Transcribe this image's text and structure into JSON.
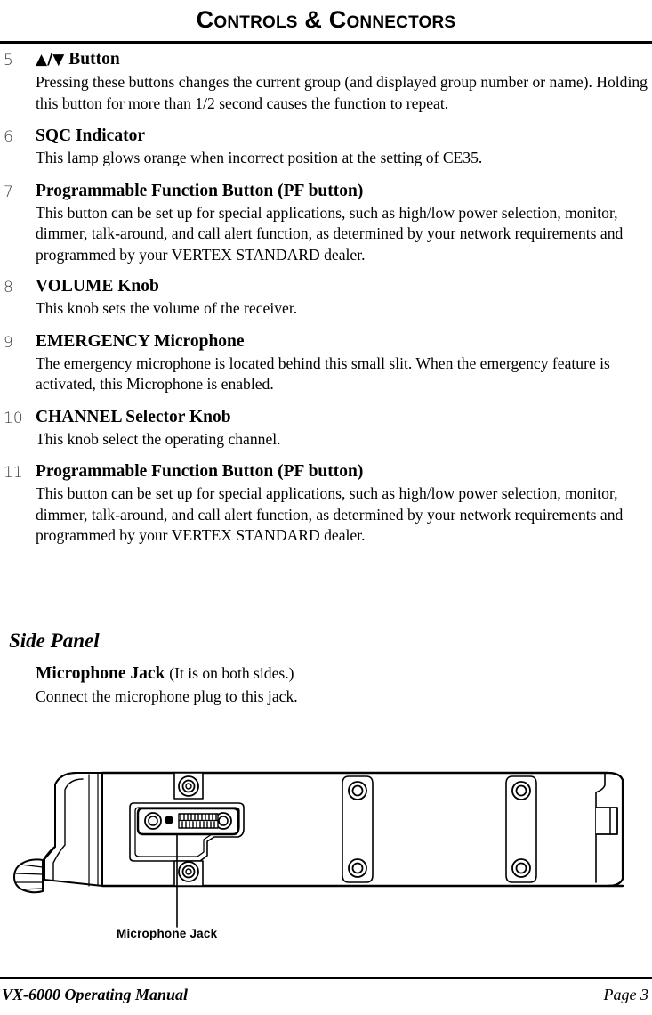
{
  "header": {
    "title": "Controls & Connectors"
  },
  "entries": [
    {
      "number": "5",
      "heading_symbol": "▲/▼",
      "heading": " Button",
      "text": "Pressing these buttons changes the current group (and displayed group number or name). Holding this button for more than 1/2 second causes the function to repeat."
    },
    {
      "number": "6",
      "heading_symbol": "",
      "heading": "SQC Indicator",
      "text": "This lamp glows orange when incorrect position at the setting of CE35."
    },
    {
      "number": "7",
      "heading_symbol": "",
      "heading": "Programmable Function Button (PF button)",
      "text": "This button can be set up for special applications, such as high/low power selection, monitor, dimmer, talk-around, and call alert function, as determined by your network requirements and programmed by your VERTEX STANDARD dealer."
    },
    {
      "number": "8",
      "heading_symbol": "",
      "heading": "VOLUME Knob",
      "text": "This knob sets the volume of the receiver."
    },
    {
      "number": "9",
      "heading_symbol": "",
      "heading": "EMERGENCY Microphone",
      "text": "The emergency microphone is located behind this small slit. When the emergency feature is activated, this Microphone is enabled."
    },
    {
      "number": "10",
      "heading_symbol": "",
      "heading": "CHANNEL Selector Knob",
      "text": "This knob select the operating channel."
    },
    {
      "number": "11",
      "heading_symbol": "",
      "heading": "Programmable Function Button (PF button)",
      "text": "This button can be set up for special applications, such as high/low power selection, monitor, dimmer, talk-around, and call alert function, as determined by your network requirements and programmed by your VERTEX STANDARD dealer."
    }
  ],
  "side_panel": {
    "section_title": "Side Panel",
    "sub_heading": "Microphone Jack",
    "sub_heading_note": "(It is on both sides.)",
    "sub_text": "Connect the microphone plug to this jack."
  },
  "illustration": {
    "callout_label": "Microphone Jack"
  },
  "footer": {
    "left": "VX-6000 Operating Manual",
    "right": "Page 3"
  },
  "colors": {
    "text": "#000000",
    "number": "#3a3a3a",
    "rule": "#000000",
    "page_background": "#ffffff"
  }
}
